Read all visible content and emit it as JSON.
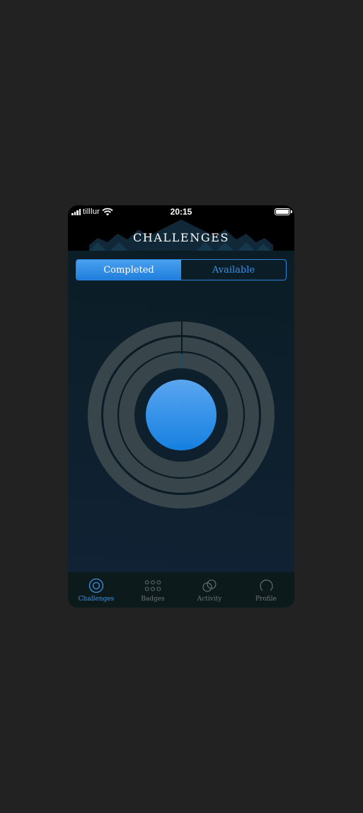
{
  "status_bar": {
    "carrier": "tilllur",
    "time": "20:15"
  },
  "header": {
    "title": "CHALLENGES"
  },
  "segmented_control": {
    "options": [
      "Completed",
      "Available"
    ],
    "selected": "Completed"
  },
  "tab_bar": {
    "tabs": [
      {
        "label": "Challenges",
        "icon": "target-icon",
        "active": true
      },
      {
        "label": "Badges",
        "icon": "badges-grid-icon",
        "active": false
      },
      {
        "label": "Activity",
        "icon": "activity-rings-icon",
        "active": false
      },
      {
        "label": "Profile",
        "icon": "profile-icon",
        "active": false
      }
    ]
  },
  "colors": {
    "accent": "#2e86de",
    "accent_light": "#4aa0f0",
    "ring": "#38454b",
    "background": "#0c1f2a",
    "tab_inactive": "#6d7678"
  }
}
